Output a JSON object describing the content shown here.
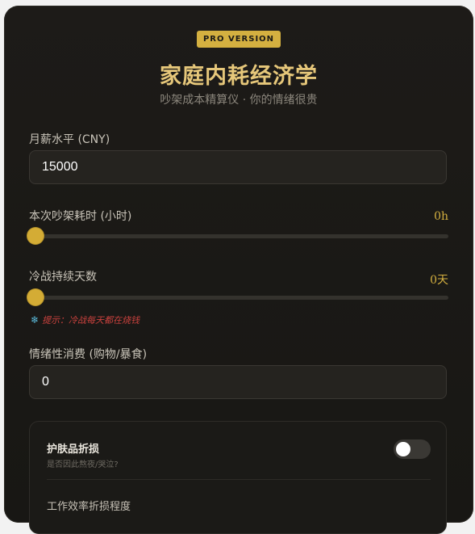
{
  "header": {
    "badge": "PRO VERSION",
    "title": "家庭内耗经济学",
    "subtitle": "吵架成本精算仪 · 你的情绪很贵"
  },
  "salary": {
    "label": "月薪水平 (CNY)",
    "value": "15000"
  },
  "argument_hours": {
    "label": "本次吵架耗时 (小时)",
    "readout": "0h",
    "level": 0
  },
  "cold_war_days": {
    "label": "冷战持续天数",
    "readout": "0天",
    "level": 0,
    "hint_icon": "snowflake-icon",
    "hint": "提示：冷战每天都在烧钱"
  },
  "emotional_spending": {
    "label": "情绪性消费 (购物/暴食)",
    "value": "0"
  },
  "options": {
    "skincare_title": "护肤品折损",
    "skincare_sub": "是否因此熬夜/哭泣?",
    "skincare_on": false,
    "efficiency_label": "工作效率折损程度"
  },
  "colors": {
    "accent": "#d4b040",
    "title": "#e6c77a",
    "hint": "#c9413e",
    "background": "#1b1a17"
  }
}
